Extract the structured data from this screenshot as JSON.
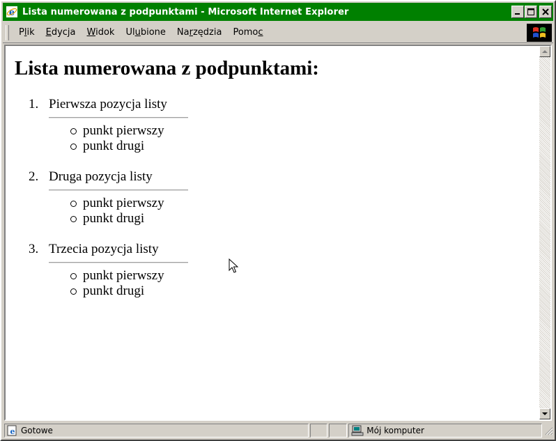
{
  "window": {
    "title": "Lista numerowana z podpunktami - Microsoft Internet Explorer"
  },
  "menu": {
    "items": [
      {
        "label": "Plik",
        "ul_index": 1
      },
      {
        "label": "Edycja",
        "ul_index": 0
      },
      {
        "label": "Widok",
        "ul_index": 0
      },
      {
        "label": "Ulubione",
        "ul_index": 2
      },
      {
        "label": "Narzędzia",
        "ul_index": 2
      },
      {
        "label": "Pomoc",
        "ul_index": 4
      }
    ]
  },
  "page": {
    "heading": "Lista numerowana z podpunktami:",
    "list": [
      {
        "number": "1.",
        "label": "Pierwsza pozycja listy",
        "subitems": [
          "punkt pierwszy",
          "punkt drugi"
        ]
      },
      {
        "number": "2.",
        "label": "Druga pozycja listy",
        "subitems": [
          "punkt pierwszy",
          "punkt drugi"
        ]
      },
      {
        "number": "3.",
        "label": "Trzecia pozycja listy",
        "subitems": [
          "punkt pierwszy",
          "punkt drugi"
        ]
      }
    ]
  },
  "status": {
    "text": "Gotowe",
    "zone": "Mój komputer"
  },
  "colors": {
    "titlebar": "#008000",
    "chrome": "#d4d0c8",
    "content_bg": "#ffffff"
  }
}
